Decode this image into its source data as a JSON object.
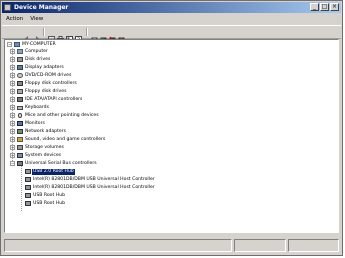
{
  "window": {
    "title": "Device Manager",
    "controls": {
      "minimize": "_",
      "maximize": "□",
      "close": "×"
    }
  },
  "menu": [
    "Action",
    "View"
  ],
  "toolbar": {
    "buttons": [
      "back-icon",
      "forward-icon",
      "view-icon",
      "print-icon",
      "properties-icon",
      "help-icon",
      "scan-icon",
      "update-icon",
      "disable-icon",
      "uninstall-icon"
    ]
  },
  "tree": {
    "root": "MY-COMPUTER",
    "categories": [
      "Computer",
      "Disk drives",
      "Display adapters",
      "DVD/CD-ROM drives",
      "Floppy disk controllers",
      "Floppy disk drives",
      "IDE ATA/ATAPI controllers",
      "Keyboards",
      "Mice and other pointing devices",
      "Monitors",
      "Network adapters",
      "Sound, video and game controllers",
      "Storage volumes",
      "System devices",
      "Universal Serial Bus controllers"
    ],
    "usb_children": [
      "USB 2.0 Root Hub",
      "Intel(R) 82801DB/DBM USB Universal Host Controller",
      "Intel(R) 82801DB/DBM USB Universal Host Controller",
      "USB Root Hub",
      "USB Root Hub"
    ],
    "selected_index": 0
  },
  "colors": {
    "title_start": "#0a246a",
    "title_end": "#a6caf0",
    "selection": "#0a246a",
    "chrome": "#d6d3ce"
  }
}
